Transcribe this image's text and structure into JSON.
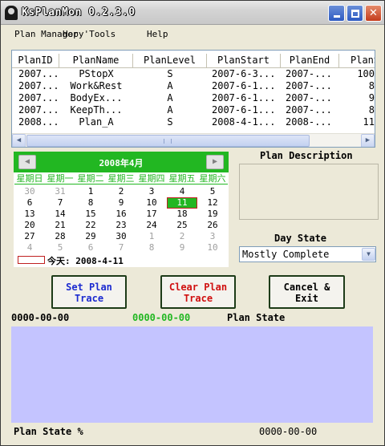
{
  "window": {
    "title": "KsPlanMon 0.2.3.0"
  },
  "menu": [
    {
      "label": "Plan Manager"
    },
    {
      "label": "Hopy'Tools"
    },
    {
      "label": "Help"
    }
  ],
  "grid": {
    "columns": [
      "PlanID",
      "PlanName",
      "PlanLevel",
      "PlanStart",
      "PlanEnd",
      "PlanSpa"
    ],
    "rows": [
      [
        "2007...",
        "PStopX",
        "S",
        "2007-6-3...",
        "2007-...",
        "100"
      ],
      [
        "2007...",
        "Work&Rest",
        "A",
        "2007-6-1...",
        "2007-...",
        "8"
      ],
      [
        "2007...",
        "BodyEx...",
        "A",
        "2007-6-1...",
        "2007-...",
        "9"
      ],
      [
        "2007...",
        "KeepTh...",
        "A",
        "2007-6-1...",
        "2007-...",
        "8"
      ],
      [
        "2008...",
        "Plan_A",
        "S",
        "2008-4-1...",
        "2008-...",
        "11"
      ]
    ]
  },
  "calendar": {
    "month_label": "2008年4月",
    "prev_glyph": "◀",
    "next_glyph": "▶",
    "weekdays": [
      "星期日",
      "星期一",
      "星期二",
      "星期三",
      "星期四",
      "星期五",
      "星期六"
    ],
    "weeks": [
      [
        {
          "d": "30",
          "dim": true
        },
        {
          "d": "31",
          "dim": true
        },
        {
          "d": "1"
        },
        {
          "d": "2"
        },
        {
          "d": "3"
        },
        {
          "d": "4"
        },
        {
          "d": "5"
        }
      ],
      [
        {
          "d": "6"
        },
        {
          "d": "7"
        },
        {
          "d": "8"
        },
        {
          "d": "9"
        },
        {
          "d": "10"
        },
        {
          "d": "11",
          "sel": true
        },
        {
          "d": "12"
        }
      ],
      [
        {
          "d": "13"
        },
        {
          "d": "14"
        },
        {
          "d": "15"
        },
        {
          "d": "16"
        },
        {
          "d": "17"
        },
        {
          "d": "18"
        },
        {
          "d": "19"
        }
      ],
      [
        {
          "d": "20"
        },
        {
          "d": "21"
        },
        {
          "d": "22"
        },
        {
          "d": "23"
        },
        {
          "d": "24"
        },
        {
          "d": "25"
        },
        {
          "d": "26"
        }
      ],
      [
        {
          "d": "27"
        },
        {
          "d": "28"
        },
        {
          "d": "29"
        },
        {
          "d": "30"
        },
        {
          "d": "1",
          "dim": true
        },
        {
          "d": "2",
          "dim": true
        },
        {
          "d": "3",
          "dim": true
        }
      ],
      [
        {
          "d": "4",
          "dim": true
        },
        {
          "d": "5",
          "dim": true
        },
        {
          "d": "6",
          "dim": true
        },
        {
          "d": "7",
          "dim": true
        },
        {
          "d": "8",
          "dim": true
        },
        {
          "d": "9",
          "dim": true
        },
        {
          "d": "10",
          "dim": true
        }
      ]
    ],
    "today_label": "今天: 2008-4-11",
    "accent_color": "#22b722"
  },
  "plan_description": {
    "label": "Plan Description",
    "text": ""
  },
  "day_state": {
    "label": "Day State",
    "selected": "Mostly Complete"
  },
  "buttons": {
    "set_trace": "Set Plan Trace",
    "clear_trace": "Clear Plan Trace",
    "cancel_exit": "Cancel & Exit"
  },
  "status": {
    "date_left": "0000-00-00",
    "date_mid": "0000-00-00",
    "plan_state_label": "Plan State",
    "plan_state_pct_label": "Plan State %",
    "date_bottom": "0000-00-00",
    "state_area_color": "#c4c4ff"
  }
}
